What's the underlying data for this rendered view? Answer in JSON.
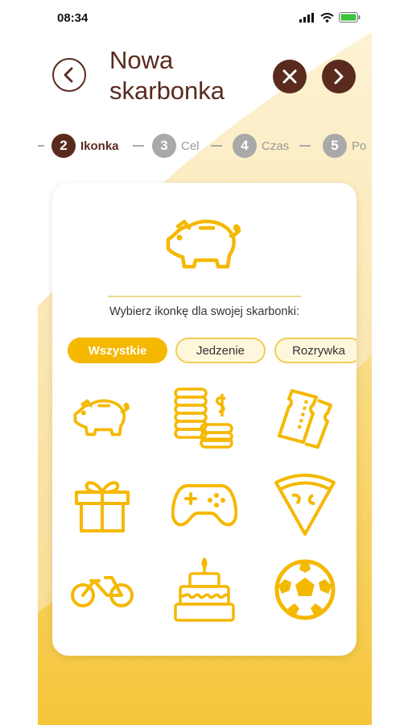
{
  "status_bar": {
    "time": "08:34"
  },
  "header": {
    "title_line1": "Nowa",
    "title_line2": "skarbonka"
  },
  "stepper": {
    "steps": [
      {
        "num": "2",
        "label": "Ikonka"
      },
      {
        "num": "3",
        "label": "Cel"
      },
      {
        "num": "4",
        "label": "Czas"
      },
      {
        "num": "5",
        "label": "Po"
      }
    ]
  },
  "card": {
    "prompt": "Wybierz ikonkę dla swojej skarbonki:",
    "categories": [
      "Wszystkie",
      "Jedzenie",
      "Rozrywka"
    ],
    "selected_category": "Wszystkie"
  },
  "icons": [
    "piggy-bank-icon",
    "coins-icon",
    "tickets-icon",
    "gift-icon",
    "gamepad-icon",
    "pizza-icon",
    "bicycle-icon",
    "cake-icon",
    "soccer-ball-icon"
  ],
  "colors": {
    "brown": "#5a2a1e",
    "accent": "#f5b800",
    "inactive_step": "#a9a9a9"
  }
}
